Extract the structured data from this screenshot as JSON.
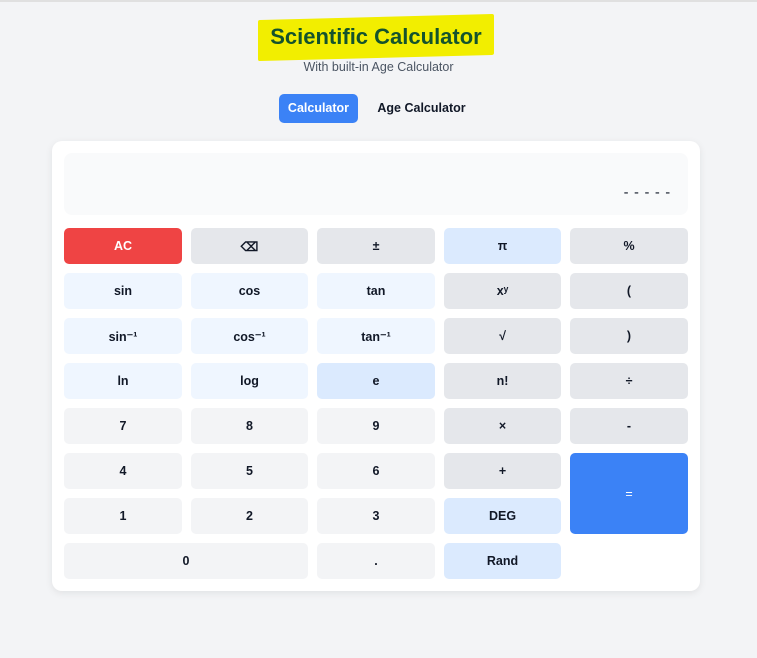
{
  "header": {
    "title": "Scientific Calculator",
    "subtitle": "With built-in Age Calculator"
  },
  "tabs": [
    {
      "label": "Calculator",
      "active": true
    },
    {
      "label": "Age Calculator",
      "active": false
    }
  ],
  "display": {
    "value": "-----"
  },
  "colors": {
    "accent": "#3b82f6",
    "clear": "#ef4444",
    "title": "#14532d",
    "highlight": "#f2ee00"
  },
  "buttons": {
    "ac": "AC",
    "backspace": "⌫",
    "sign": "±",
    "pi": "π",
    "percent": "%",
    "sin": "sin",
    "cos": "cos",
    "tan": "tan",
    "power": "xʸ",
    "open_paren": "(",
    "asin": "sin⁻¹",
    "acos": "cos⁻¹",
    "atan": "tan⁻¹",
    "sqrt": "√",
    "close_paren": ")",
    "ln": "ln",
    "log": "log",
    "e": "e",
    "factorial": "n!",
    "divide": "÷",
    "seven": "7",
    "eight": "8",
    "nine": "9",
    "multiply": "×",
    "minus": "-",
    "four": "4",
    "five": "5",
    "six": "6",
    "plus": "+",
    "equals": "=",
    "one": "1",
    "two": "2",
    "three": "3",
    "deg": "DEG",
    "zero": "0",
    "dot": ".",
    "rand": "Rand"
  }
}
